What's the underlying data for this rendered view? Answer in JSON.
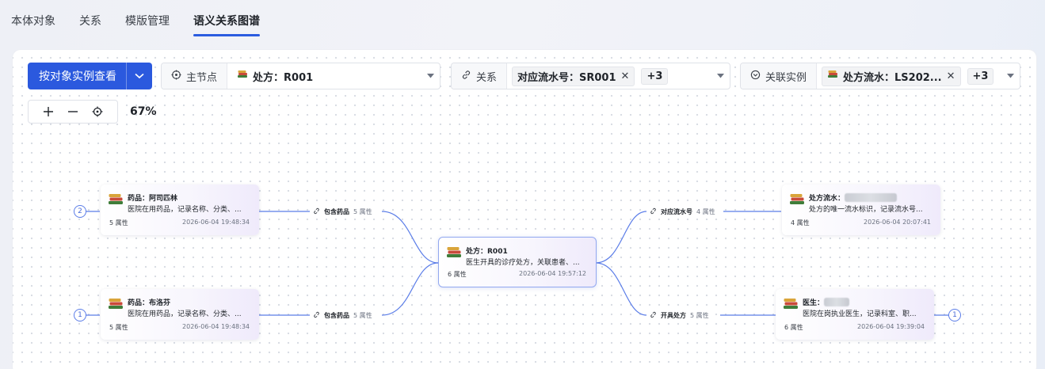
{
  "tabs": [
    {
      "label": "本体对象"
    },
    {
      "label": "关系"
    },
    {
      "label": "模版管理"
    },
    {
      "label": "语义关系图谱",
      "active": true
    }
  ],
  "toolbar": {
    "view_button": "按对象实例查看",
    "main_node": {
      "label": "主节点",
      "value": "处方：R001"
    },
    "relation": {
      "label": "关系",
      "chip": "对应流水号：SR001",
      "more": "+3"
    },
    "instance": {
      "label": "关联实例",
      "chip": "处方流水：LS202...",
      "more": "+3"
    }
  },
  "zoom": {
    "level": "67%"
  },
  "nodes": {
    "aspirin": {
      "title": "药品：阿司匹林",
      "desc": "医院在用药品，记录名称、分类、...",
      "attrs": "5 属性",
      "time": "2026-06-04 19:48:34"
    },
    "ibuprofen": {
      "title": "药品：布洛芬",
      "desc": "医院在用药品，记录名称、分类、...",
      "attrs": "5 属性",
      "time": "2026-06-04 19:48:34"
    },
    "prescription": {
      "title": "处方：R001",
      "desc": "医生开具的诊疗处方，关联患者、...",
      "attrs": "6 属性",
      "time": "2026-06-04 19:57:12"
    },
    "serial": {
      "title": "处方流水：",
      "desc": "处方的唯一流水标识，记录流水号...",
      "attrs": "4 属性",
      "time": "2026-06-04 20:07:41"
    },
    "doctor": {
      "title": "医生：",
      "desc": "医院在岗执业医生，记录科室、职...",
      "attrs": "6 属性",
      "time": "2026-06-04 19:39:04"
    }
  },
  "edges": {
    "contains1": {
      "name": "包含药品",
      "attrs": "5 属性"
    },
    "contains2": {
      "name": "包含药品",
      "attrs": "5 属性"
    },
    "serial": {
      "name": "对应流水号",
      "attrs": "4 属性"
    },
    "prescribe": {
      "name": "开具处方",
      "attrs": "5 属性"
    }
  },
  "counters": {
    "aspirin": "2",
    "ibuprofen": "1",
    "doctor": "1"
  },
  "colors": {
    "accent": "#2b59de",
    "node_border": "#92a8f0",
    "edge": "#5b7de8"
  },
  "icons": [
    "target-icon",
    "link-icon",
    "check-circle-icon",
    "books-icon",
    "plus-icon",
    "minus-icon",
    "locate-icon",
    "chevron-down-icon",
    "close-icon"
  ]
}
